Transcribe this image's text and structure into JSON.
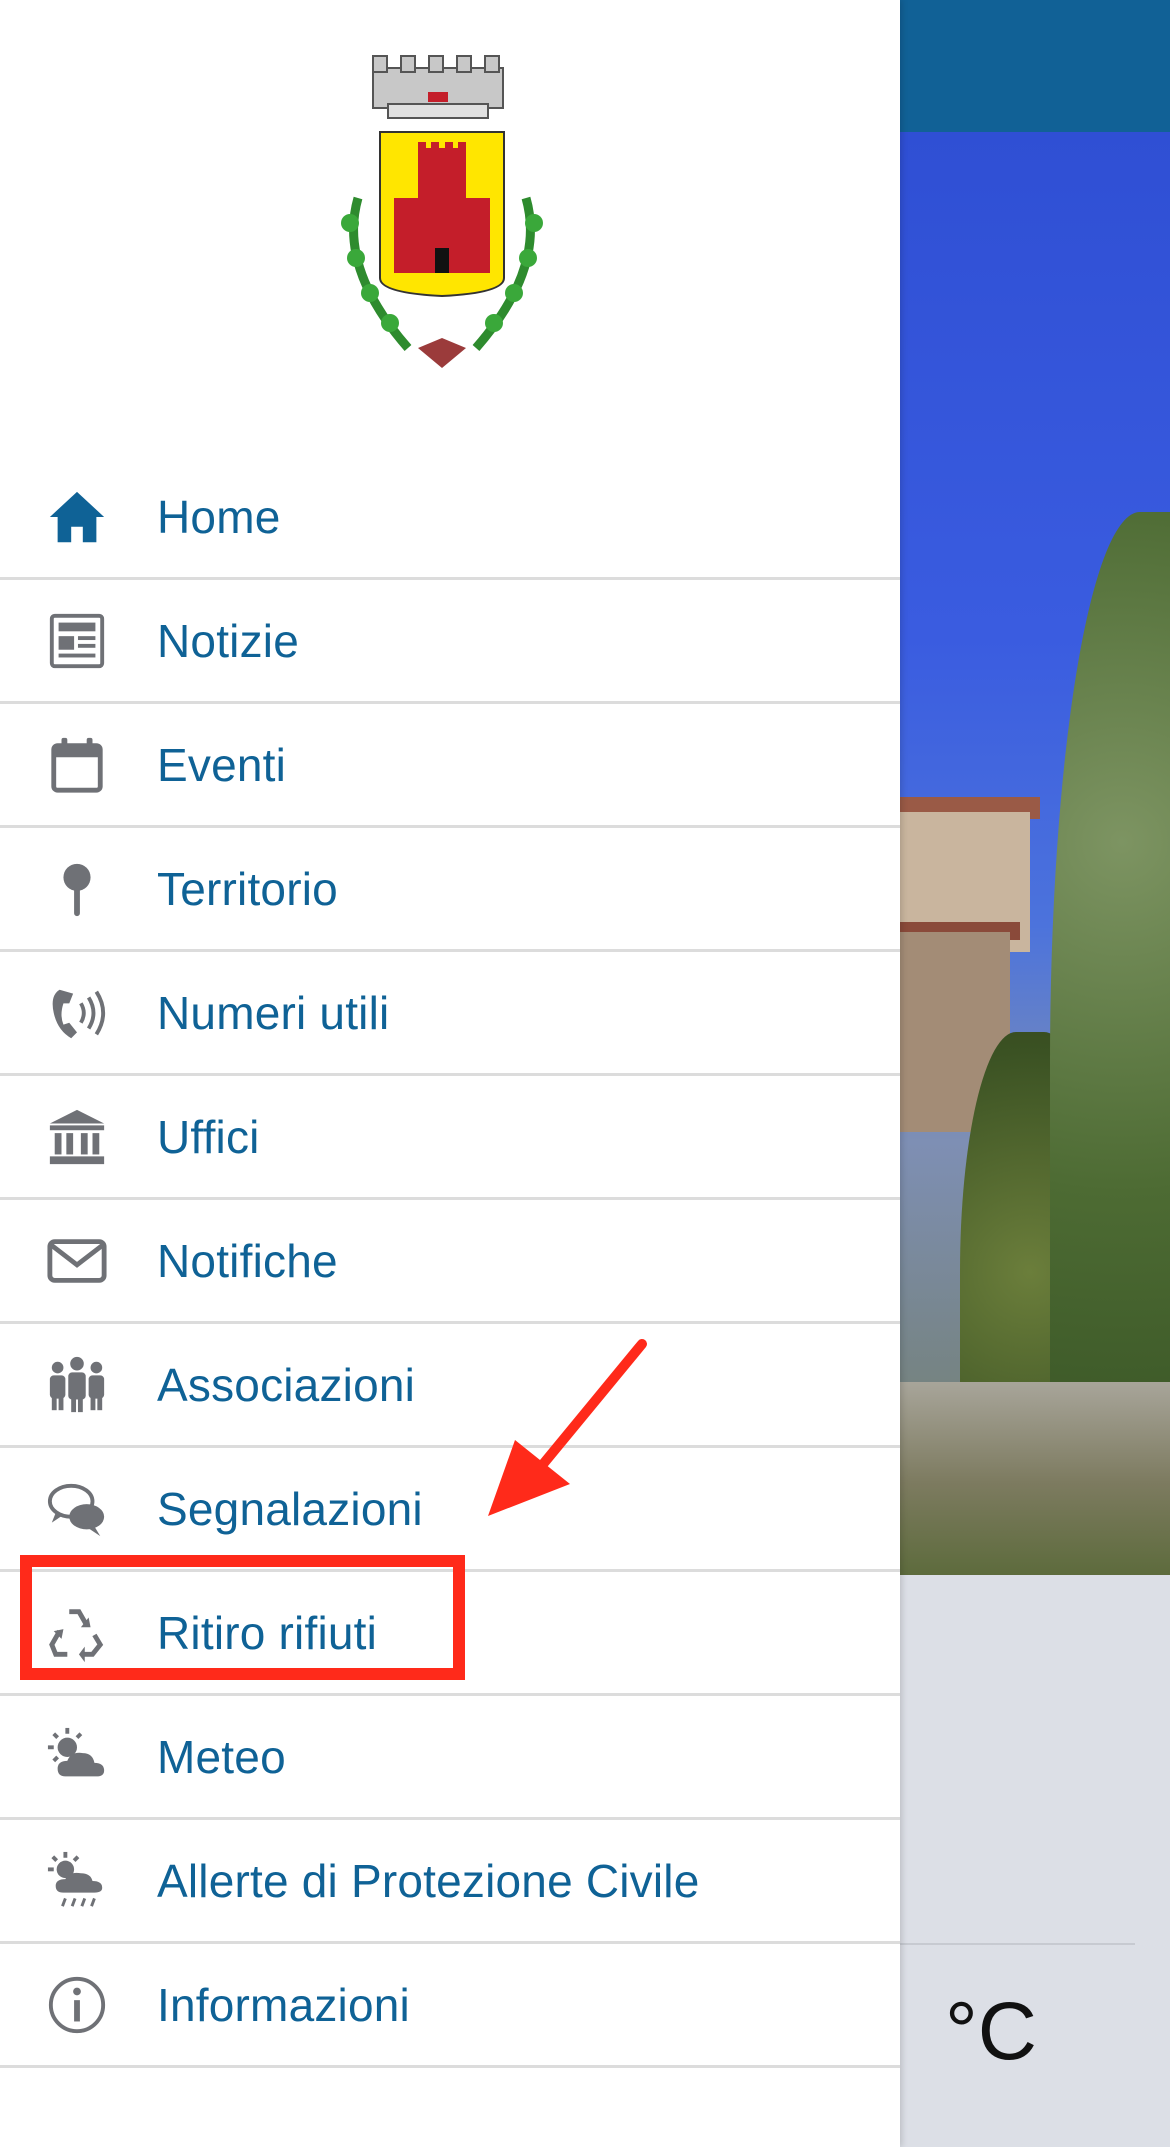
{
  "drawer": {
    "logo": {
      "name": "coat-of-arms"
    },
    "menu": [
      {
        "label": "Home",
        "icon": "home-icon"
      },
      {
        "label": "Notizie",
        "icon": "newspaper-icon"
      },
      {
        "label": "Eventi",
        "icon": "calendar-icon"
      },
      {
        "label": "Territorio",
        "icon": "map-pin-icon"
      },
      {
        "label": "Numeri utili",
        "icon": "phone-icon"
      },
      {
        "label": "Uffici",
        "icon": "bank-icon"
      },
      {
        "label": "Notifiche",
        "icon": "envelope-icon"
      },
      {
        "label": "Associazioni",
        "icon": "group-icon"
      },
      {
        "label": "Segnalazioni",
        "icon": "chat-bubbles-icon"
      },
      {
        "label": "Ritiro rifiuti",
        "icon": "recycle-icon"
      },
      {
        "label": "Meteo",
        "icon": "partly-cloudy-icon"
      },
      {
        "label": "Allerte di Protezione Civile",
        "icon": "weather-alert-icon"
      },
      {
        "label": "Informazioni",
        "icon": "info-icon"
      }
    ]
  },
  "background": {
    "temperature_unit": "°C"
  },
  "colors": {
    "accent": "#0f6296",
    "icon_gray": "#6f7176",
    "topbar": "#116196",
    "annotation_red": "#ff2a1a"
  }
}
